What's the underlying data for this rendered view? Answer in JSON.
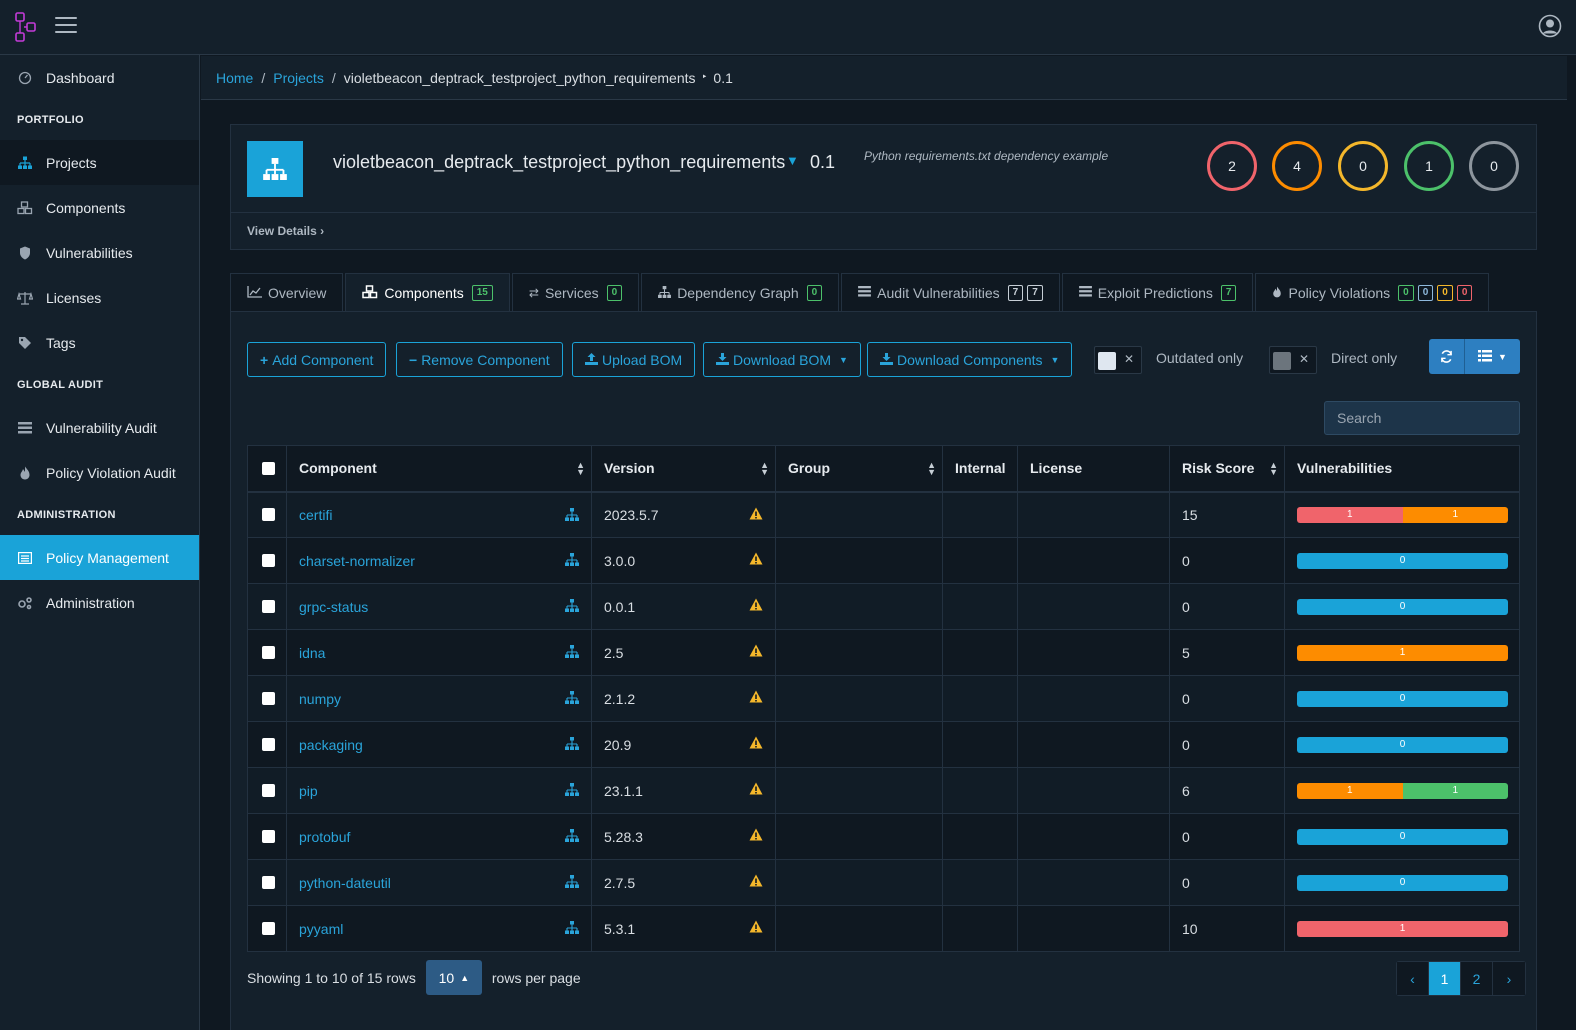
{
  "nav": {
    "dashboard": "Dashboard",
    "portfolio_title": "PORTFOLIO",
    "projects": "Projects",
    "components": "Components",
    "vulnerabilities": "Vulnerabilities",
    "licenses": "Licenses",
    "tags": "Tags",
    "global_audit_title": "GLOBAL AUDIT",
    "vulnerability_audit": "Vulnerability Audit",
    "policy_violation_audit": "Policy Violation Audit",
    "administration_title": "ADMINISTRATION",
    "policy_management": "Policy Management",
    "administration": "Administration"
  },
  "breadcrumb": {
    "home": "Home",
    "projects": "Projects",
    "project": "violetbeacon_deptrack_testproject_python_requirements",
    "version_sep": "‣",
    "version": "0.1"
  },
  "project": {
    "name": "violetbeacon_deptrack_testproject_python_requirements",
    "version": "0.1",
    "description": "Python requirements.txt dependency example",
    "view_details": "View Details",
    "severity_counts": {
      "critical": "2",
      "high": "4",
      "medium": "0",
      "low": "1",
      "unassigned": "0"
    },
    "severity_colors": {
      "critical": "#f0646b",
      "high": "#fd8c00",
      "medium": "#f4b72b",
      "low": "#4cc16a",
      "unassigned": "#8d959d"
    }
  },
  "tabs": {
    "overview": "Overview",
    "components": "Components",
    "components_count": "15",
    "services": "Services",
    "services_count": "0",
    "dependency_graph": "Dependency Graph",
    "dependency_graph_count": "0",
    "audit_vulnerabilities": "Audit Vulnerabilities",
    "audit_count_a": "7",
    "audit_count_b": "7",
    "exploit_predictions": "Exploit Predictions",
    "exploit_count": "7",
    "policy_violations": "Policy Violations",
    "pv_counts": [
      "0",
      "0",
      "0",
      "0"
    ]
  },
  "toolbar": {
    "add_component": "Add Component",
    "remove_component": "Remove Component",
    "upload_bom": "Upload BOM",
    "download_bom": "Download BOM",
    "download_components": "Download Components",
    "outdated_only": "Outdated only",
    "direct_only": "Direct only",
    "search_placeholder": "Search"
  },
  "table": {
    "headers": {
      "component": "Component",
      "version": "Version",
      "group": "Group",
      "internal": "Internal",
      "license": "License",
      "risk_score": "Risk Score",
      "vulnerabilities": "Vulnerabilities"
    },
    "rows": [
      {
        "name": "certifi",
        "version": "2023.5.7",
        "group": "",
        "internal": "",
        "license": "",
        "risk": "15",
        "vulns": [
          {
            "label": "1",
            "color": "#f0646b",
            "weight": 1
          },
          {
            "label": "1",
            "color": "#fd8c00",
            "weight": 1
          }
        ]
      },
      {
        "name": "charset-normalizer",
        "version": "3.0.0",
        "group": "",
        "internal": "",
        "license": "",
        "risk": "0",
        "vulns": [
          {
            "label": "0",
            "color": "#1aa3d8",
            "weight": 1
          }
        ]
      },
      {
        "name": "grpc-status",
        "version": "0.0.1",
        "group": "",
        "internal": "",
        "license": "",
        "risk": "0",
        "vulns": [
          {
            "label": "0",
            "color": "#1aa3d8",
            "weight": 1
          }
        ]
      },
      {
        "name": "idna",
        "version": "2.5",
        "group": "",
        "internal": "",
        "license": "",
        "risk": "5",
        "vulns": [
          {
            "label": "1",
            "color": "#fd8c00",
            "weight": 1
          }
        ]
      },
      {
        "name": "numpy",
        "version": "2.1.2",
        "group": "",
        "internal": "",
        "license": "",
        "risk": "0",
        "vulns": [
          {
            "label": "0",
            "color": "#1aa3d8",
            "weight": 1
          }
        ]
      },
      {
        "name": "packaging",
        "version": "20.9",
        "group": "",
        "internal": "",
        "license": "",
        "risk": "0",
        "vulns": [
          {
            "label": "0",
            "color": "#1aa3d8",
            "weight": 1
          }
        ]
      },
      {
        "name": "pip",
        "version": "23.1.1",
        "group": "",
        "internal": "",
        "license": "",
        "risk": "6",
        "vulns": [
          {
            "label": "1",
            "color": "#fd8c00",
            "weight": 1
          },
          {
            "label": "1",
            "color": "#4cc16a",
            "weight": 1
          }
        ]
      },
      {
        "name": "protobuf",
        "version": "5.28.3",
        "group": "",
        "internal": "",
        "license": "",
        "risk": "0",
        "vulns": [
          {
            "label": "0",
            "color": "#1aa3d8",
            "weight": 1
          }
        ]
      },
      {
        "name": "python-dateutil",
        "version": "2.7.5",
        "group": "",
        "internal": "",
        "license": "",
        "risk": "0",
        "vulns": [
          {
            "label": "0",
            "color": "#1aa3d8",
            "weight": 1
          }
        ]
      },
      {
        "name": "pyyaml",
        "version": "5.3.1",
        "group": "",
        "internal": "",
        "license": "",
        "risk": "10",
        "vulns": [
          {
            "label": "1",
            "color": "#f0646b",
            "weight": 1
          }
        ]
      }
    ]
  },
  "pagination": {
    "showing": "Showing 1 to 10 of 15 rows",
    "page_size": "10",
    "rows_per_page": "rows per page",
    "prev": "‹",
    "pages": [
      "1",
      "2"
    ],
    "next": "›"
  }
}
